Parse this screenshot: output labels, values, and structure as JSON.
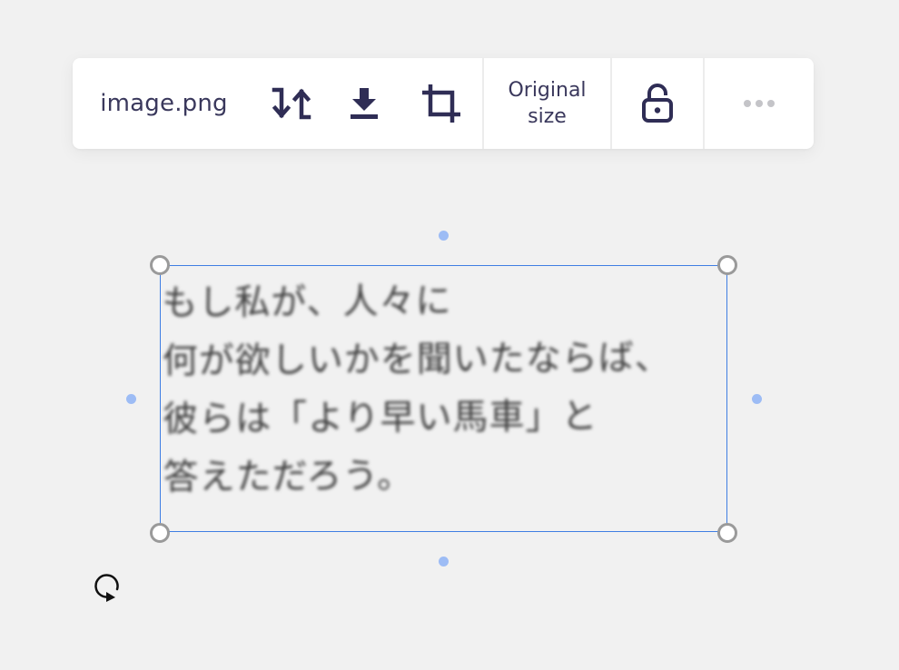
{
  "toolbar": {
    "filename": "image.png",
    "flip_icon": "flip-vertical-icon",
    "download_icon": "download-icon",
    "crop_icon": "crop-icon",
    "original_size_line1": "Original",
    "original_size_line2": "size",
    "lock_icon": "unlock-icon",
    "more_icon": "more-horizontal-icon"
  },
  "image": {
    "lines": [
      "もし私が、人々に",
      "何が欲しいかを聞いたならば、",
      "彼らは「より早い馬車」と",
      "答えただろう。"
    ]
  },
  "colors": {
    "background": "#f1f1f1",
    "toolbar_bg": "#ffffff",
    "icon": "#2f2d55",
    "selection": "#3f7ee3",
    "handle_mid": "#9dbcf5",
    "handle_corner": "#9a9a9a"
  },
  "rotate_icon": "rotate-handle-icon"
}
